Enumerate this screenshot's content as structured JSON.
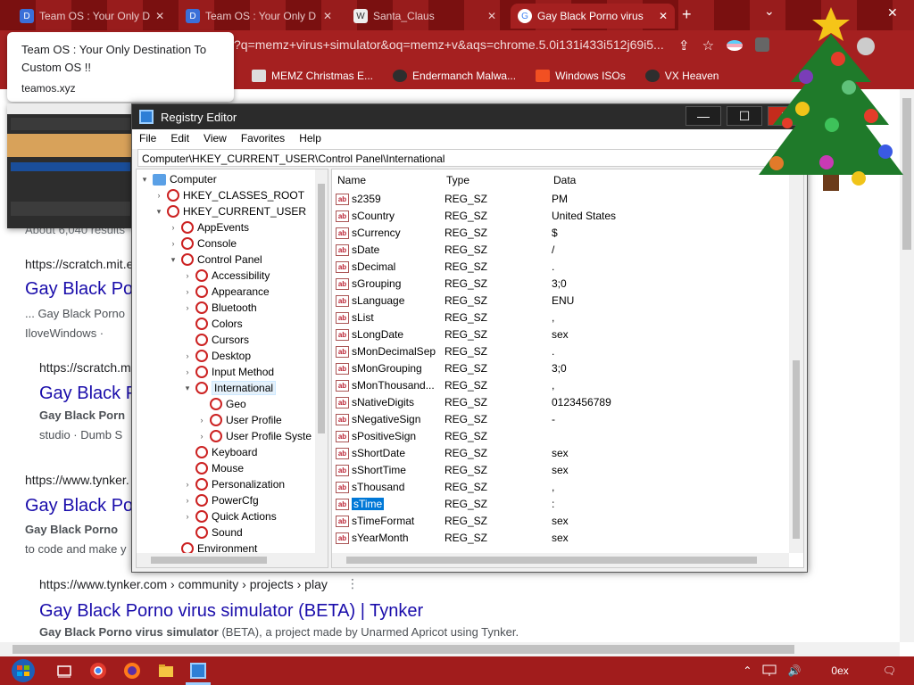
{
  "browser": {
    "tabs": [
      {
        "title": "Team OS : Your Only D",
        "active": false
      },
      {
        "title": "Team OS : Your Only D",
        "active": false
      },
      {
        "title": "Santa_Claus",
        "active": false
      },
      {
        "title": "Gay Black Porno virus",
        "active": true
      }
    ],
    "url": "?q=memz+virus+simulator&oq=memz+v&aqs=chrome.5.0i131i433i512j69i5...",
    "bookmarks": [
      "MEMZ Christmas E...",
      "Endermanch Malwa...",
      "Windows ISOs",
      "VX Heaven"
    ],
    "hovercard": {
      "title": "Team OS : Your Only Destination To Custom OS !!",
      "domain": "teamos.xyz"
    }
  },
  "serp": {
    "stats": "About 6,040 results",
    "results": [
      {
        "cite": "https://scratch.mit.e",
        "title": "Gay Black Po",
        "snippet1": "... Gay Black Porno",
        "snippet2": "IloveWindows ·"
      },
      {
        "cite": "https://scratch.m",
        "title": "Gay Black P",
        "snippet1": "Gay Black Porn",
        "snippet2": "studio · Dumb S"
      },
      {
        "cite": "https://www.tynker.",
        "title": "Gay Black Po",
        "snippet1": "Gay Black Porno",
        "snippet2": "to code and make y"
      },
      {
        "cite": "https://www.tynker.com › community › projects › play",
        "title": "Gay Black Porno virus simulator (BETA) | Tynker",
        "snippet_bold": "Gay Black Porno virus simulator",
        "snippet_rest": " (BETA), a project made by Unarmed Apricot using Tynker."
      }
    ]
  },
  "regedit": {
    "title": "Registry Editor",
    "menu": [
      "File",
      "Edit",
      "View",
      "Favorites",
      "Help"
    ],
    "address": "Computer\\HKEY_CURRENT_USER\\Control Panel\\International",
    "tree": [
      {
        "label": "Computer",
        "level": 0,
        "twisty": "▾",
        "kind": "computer"
      },
      {
        "label": "HKEY_CLASSES_ROOT",
        "level": 1,
        "twisty": "›"
      },
      {
        "label": "HKEY_CURRENT_USER",
        "level": 1,
        "twisty": "▾"
      },
      {
        "label": "AppEvents",
        "level": 2,
        "twisty": "›"
      },
      {
        "label": "Console",
        "level": 2,
        "twisty": "›"
      },
      {
        "label": "Control Panel",
        "level": 2,
        "twisty": "▾"
      },
      {
        "label": "Accessibility",
        "level": 3,
        "twisty": "›"
      },
      {
        "label": "Appearance",
        "level": 3,
        "twisty": "›"
      },
      {
        "label": "Bluetooth",
        "level": 3,
        "twisty": "›"
      },
      {
        "label": "Colors",
        "level": 3,
        "twisty": ""
      },
      {
        "label": "Cursors",
        "level": 3,
        "twisty": ""
      },
      {
        "label": "Desktop",
        "level": 3,
        "twisty": "›"
      },
      {
        "label": "Input Method",
        "level": 3,
        "twisty": "›"
      },
      {
        "label": "International",
        "level": 3,
        "twisty": "▾",
        "selected": true
      },
      {
        "label": "Geo",
        "level": 4,
        "twisty": ""
      },
      {
        "label": "User Profile",
        "level": 4,
        "twisty": "›"
      },
      {
        "label": "User Profile Syste",
        "level": 4,
        "twisty": "›"
      },
      {
        "label": "Keyboard",
        "level": 3,
        "twisty": ""
      },
      {
        "label": "Mouse",
        "level": 3,
        "twisty": ""
      },
      {
        "label": "Personalization",
        "level": 3,
        "twisty": "›"
      },
      {
        "label": "PowerCfg",
        "level": 3,
        "twisty": "›"
      },
      {
        "label": "Quick Actions",
        "level": 3,
        "twisty": "›"
      },
      {
        "label": "Sound",
        "level": 3,
        "twisty": ""
      },
      {
        "label": "Environment",
        "level": 2,
        "twisty": ""
      }
    ],
    "columns": [
      "Name",
      "Type",
      "Data"
    ],
    "values": [
      {
        "name": "s2359",
        "type": "REG_SZ",
        "data": "PM"
      },
      {
        "name": "sCountry",
        "type": "REG_SZ",
        "data": "United States"
      },
      {
        "name": "sCurrency",
        "type": "REG_SZ",
        "data": "$"
      },
      {
        "name": "sDate",
        "type": "REG_SZ",
        "data": "/"
      },
      {
        "name": "sDecimal",
        "type": "REG_SZ",
        "data": "."
      },
      {
        "name": "sGrouping",
        "type": "REG_SZ",
        "data": "3;0"
      },
      {
        "name": "sLanguage",
        "type": "REG_SZ",
        "data": "ENU"
      },
      {
        "name": "sList",
        "type": "REG_SZ",
        "data": ","
      },
      {
        "name": "sLongDate",
        "type": "REG_SZ",
        "data": "sex"
      },
      {
        "name": "sMonDecimalSep",
        "type": "REG_SZ",
        "data": "."
      },
      {
        "name": "sMonGrouping",
        "type": "REG_SZ",
        "data": "3;0"
      },
      {
        "name": "sMonThousand...",
        "type": "REG_SZ",
        "data": ","
      },
      {
        "name": "sNativeDigits",
        "type": "REG_SZ",
        "data": "0123456789"
      },
      {
        "name": "sNegativeSign",
        "type": "REG_SZ",
        "data": "-"
      },
      {
        "name": "sPositiveSign",
        "type": "REG_SZ",
        "data": ""
      },
      {
        "name": "sShortDate",
        "type": "REG_SZ",
        "data": "sex"
      },
      {
        "name": "sShortTime",
        "type": "REG_SZ",
        "data": "sex"
      },
      {
        "name": "sThousand",
        "type": "REG_SZ",
        "data": ","
      },
      {
        "name": "sTime",
        "type": "REG_SZ",
        "data": ":",
        "selected": true
      },
      {
        "name": "sTimeFormat",
        "type": "REG_SZ",
        "data": "sex"
      },
      {
        "name": "sYearMonth",
        "type": "REG_SZ",
        "data": "sex"
      }
    ]
  },
  "taskbar": {
    "clock": "0ex"
  },
  "icons": {
    "reg_value": "ab",
    "minimize": "—",
    "maximize": "☐",
    "close": "✕",
    "tab_close": "✕",
    "new_tab": "+",
    "share": "⇪",
    "star": "☆",
    "speaker": "🔊",
    "notification": "🗨",
    "chevron_up": "⌃"
  }
}
